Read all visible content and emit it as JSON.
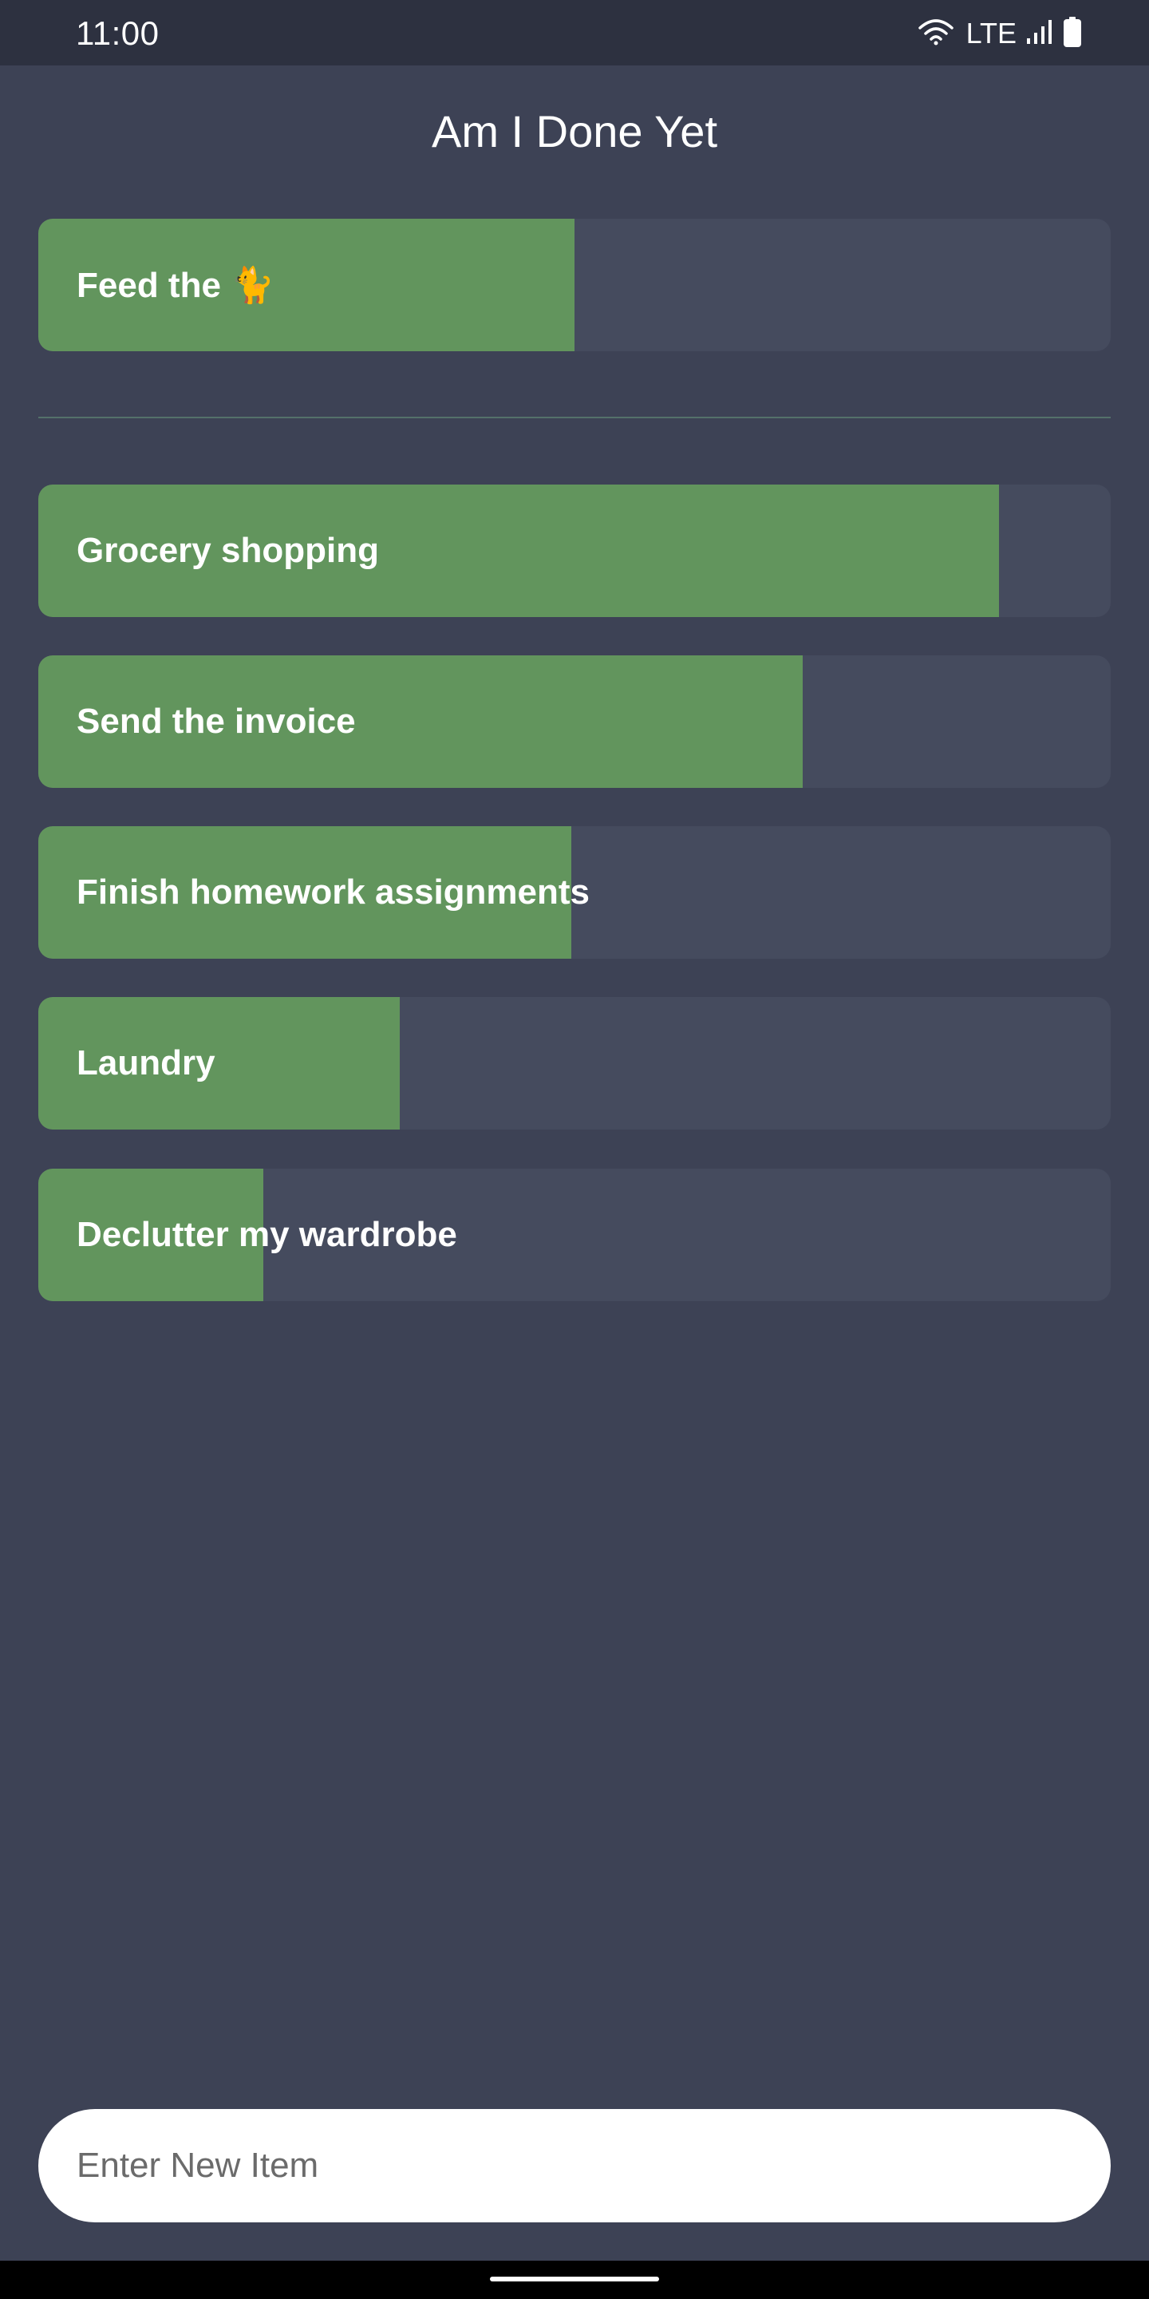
{
  "status_bar": {
    "time": "11:00",
    "network": "LTE",
    "icons": [
      "wifi-icon",
      "signal-icon",
      "battery-icon"
    ]
  },
  "app": {
    "title": "Am I Done Yet"
  },
  "pinned_items": [
    {
      "label": "Feed the 🐈",
      "progress": 0.5
    }
  ],
  "items": [
    {
      "label": "Grocery shopping",
      "progress": 0.896
    },
    {
      "label": "Send the invoice",
      "progress": 0.713
    },
    {
      "label": "Finish homework assignments",
      "progress": 0.497
    },
    {
      "label": "Laundry",
      "progress": 0.337
    },
    {
      "label": "Declutter my wardrobe",
      "progress": 0.21
    }
  ],
  "new_item": {
    "placeholder": "Enter New Item",
    "value": ""
  },
  "colors": {
    "background": "#3d4255",
    "status_bar": "#2d3140",
    "item_track": "#454b5e",
    "progress_fill": "#62955d",
    "divider": "#54706a"
  }
}
